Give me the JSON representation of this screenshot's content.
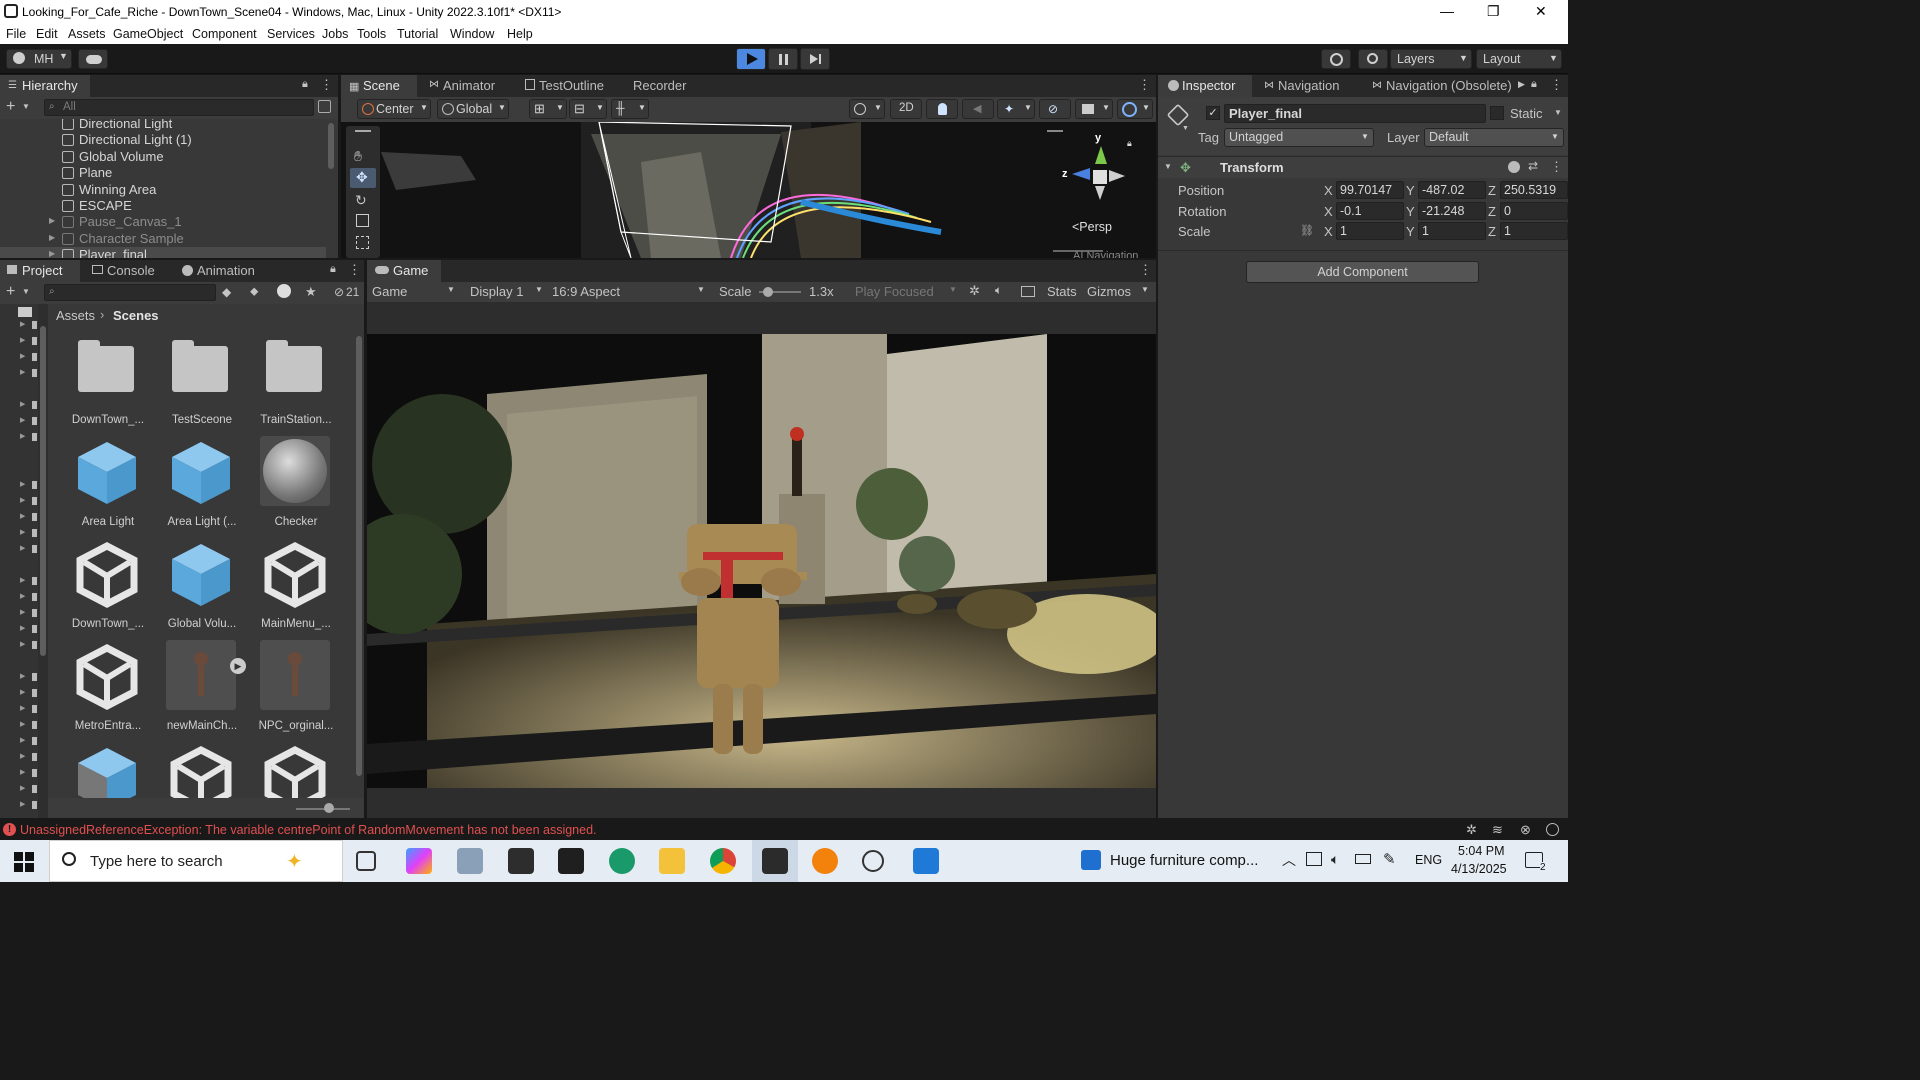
{
  "window": {
    "title": "Looking_For_Cafe_Riche - DownTown_Scene04 - Windows, Mac, Linux - Unity 2022.3.10f1* <DX11>",
    "minimize": "—",
    "maximize": "❐",
    "close": "✕"
  },
  "menu": [
    "File",
    "Edit",
    "Assets",
    "GameObject",
    "Component",
    "Services",
    "Jobs",
    "Tools",
    "Tutorial",
    "Window",
    "Help"
  ],
  "toolbar": {
    "account": "MH",
    "layers": "Layers",
    "layout": "Layout"
  },
  "hierarchy": {
    "tab": "Hierarchy",
    "search_placeholder": "All",
    "items": [
      {
        "label": "Directional Light",
        "dim": false,
        "expand": false
      },
      {
        "label": "Directional Light (1)",
        "dim": false,
        "expand": false
      },
      {
        "label": "Global Volume",
        "dim": false,
        "expand": false
      },
      {
        "label": "Plane",
        "dim": false,
        "expand": false
      },
      {
        "label": "Winning Area",
        "dim": false,
        "expand": false
      },
      {
        "label": "ESCAPE",
        "dim": false,
        "expand": false
      },
      {
        "label": "Pause_Canvas_1",
        "dim": true,
        "expand": true
      },
      {
        "label": "Character Sample",
        "dim": true,
        "expand": true
      },
      {
        "label": "Player_final",
        "dim": false,
        "expand": true
      }
    ]
  },
  "scene": {
    "tabs": [
      "Scene",
      "Animator",
      "TestOutline",
      "Recorder"
    ],
    "pivot": "Center",
    "space": "Global",
    "mode2d": "2D",
    "gizmo": {
      "y": "y",
      "z": "z",
      "persp": "<Persp"
    },
    "overlay": "AI Navigation"
  },
  "project": {
    "tabs": [
      "Project",
      "Console",
      "Animation"
    ],
    "count": "21",
    "breadcrumb": [
      "Assets",
      "Scenes"
    ],
    "assets": [
      {
        "label": "DownTown_...",
        "kind": "folder"
      },
      {
        "label": "TestSceone",
        "kind": "folder"
      },
      {
        "label": "TrainStation...",
        "kind": "folder"
      },
      {
        "label": "Area Light",
        "kind": "bluecube"
      },
      {
        "label": "Area Light (...",
        "kind": "bluecube"
      },
      {
        "label": "Checker",
        "kind": "sphere"
      },
      {
        "label": "DownTown_...",
        "kind": "unity"
      },
      {
        "label": "Global Volu...",
        "kind": "bluecube"
      },
      {
        "label": "MainMenu_...",
        "kind": "unity"
      },
      {
        "label": "MetroEntra...",
        "kind": "unity"
      },
      {
        "label": "newMainCh...",
        "kind": "model"
      },
      {
        "label": "NPC_orginal...",
        "kind": "model"
      },
      {
        "label": "",
        "kind": "stripecube"
      },
      {
        "label": "",
        "kind": "unity"
      },
      {
        "label": "",
        "kind": "unity"
      }
    ]
  },
  "game": {
    "tab": "Game",
    "view": "Game",
    "display": "Display 1",
    "aspect": "16:9 Aspect",
    "scale_label": "Scale",
    "scale_value": "1.3x",
    "play_mode": "Play Focused",
    "stats": "Stats",
    "gizmos": "Gizmos",
    "scale_fraction": 0.1
  },
  "inspector": {
    "tabs": [
      "Inspector",
      "Navigation",
      "Navigation (Obsolete)"
    ],
    "object_name": "Player_final",
    "static_label": "Static",
    "tag_label": "Tag",
    "tag_value": "Untagged",
    "layer_label": "Layer",
    "layer_value": "Default",
    "component": "Transform",
    "rows": [
      {
        "label": "Position",
        "x": "99.70147",
        "y": "-487.02",
        "z": "250.5319"
      },
      {
        "label": "Rotation",
        "x": "-0.1",
        "y": "-21.248",
        "z": "0"
      },
      {
        "label": "Scale",
        "x": "1",
        "y": "1",
        "z": "1"
      }
    ],
    "axis": [
      "X",
      "Y",
      "Z"
    ],
    "add_component": "Add Component"
  },
  "status": {
    "error": "UnassignedReferenceException: The variable centrePoint of RandomMovement has not been assigned."
  },
  "taskbar": {
    "search_placeholder": "Type here to search",
    "news": "Huge furniture comp...",
    "lang": "ENG",
    "time": "5:04 PM",
    "date": "4/13/2025",
    "notif": "2"
  },
  "colors": {
    "accent": "#4a8ad8",
    "panel": "#383838",
    "error": "#e05050",
    "play_blue": "#4d88e0",
    "gizmo_y": "#7cc84a",
    "gizmo_z": "#4a80e0"
  }
}
